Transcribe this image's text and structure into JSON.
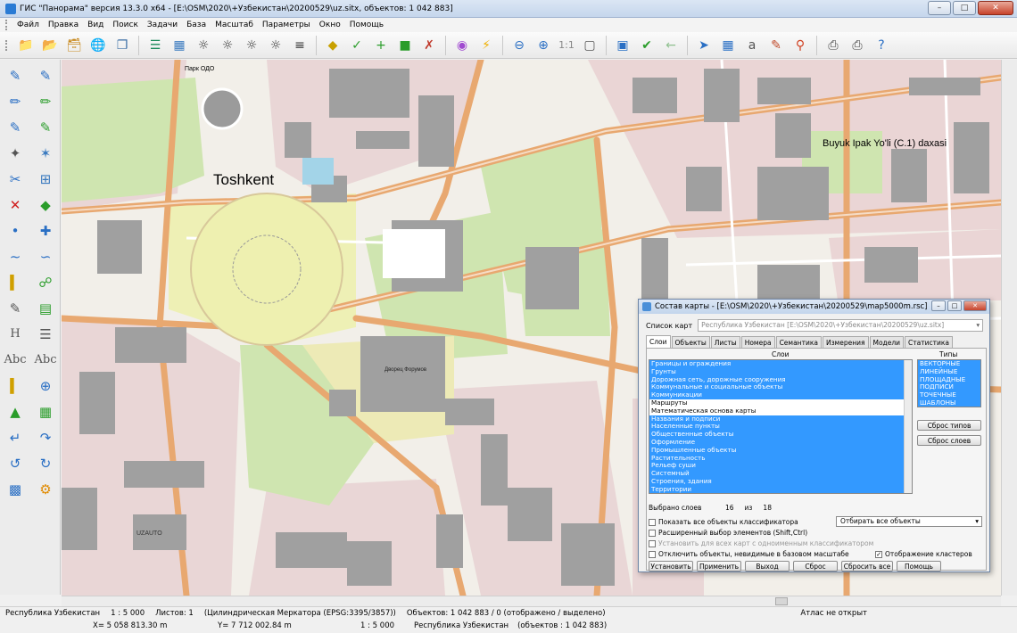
{
  "window": {
    "title": "ГИС \"Панорама\" версия 13.3.0 x64 - [E:\\OSM\\2020\\+Узбекистан\\20200529\\uz.sitx, объектов: 1 042 883]",
    "min": "–",
    "max": "□",
    "close": "✕"
  },
  "menu": [
    "Файл",
    "Правка",
    "Вид",
    "Поиск",
    "Задачи",
    "База",
    "Масштаб",
    "Параметры",
    "Окно",
    "Помощь"
  ],
  "toolbar": {
    "scale_label": "1:1"
  },
  "left_tools": {
    "text1": "H",
    "text2": "Abc",
    "text3": "Abc"
  },
  "map": {
    "labels": {
      "city": "Toshkent",
      "street": "Buyuk Ipak Yo'li (C.1) daxasi",
      "park": "Парк ОДО",
      "uzauto": "UZAUTO",
      "square": "Дворец Форумов"
    }
  },
  "dialog": {
    "title": "Состав карты - [E:\\OSM\\2020\\+Узбекистан\\20200529\\map5000m.rsc]",
    "map_list_label": "Список карт",
    "map_list_value": "Республика Узбекистан [E:\\OSM\\2020\\+Узбекистан\\20200529\\uz.sitx]",
    "tabs": [
      "Слои",
      "Объекты",
      "Листы",
      "Номера",
      "Семантика",
      "Измерения",
      "Модели",
      "Статистика"
    ],
    "layers_header": "Слои",
    "types_header": "Типы",
    "layers": [
      {
        "name": "Границы и ограждения",
        "selected": true
      },
      {
        "name": "Грунты",
        "selected": true
      },
      {
        "name": "Дорожная сеть, дорожные сооружения",
        "selected": true
      },
      {
        "name": "Коммунальные и социальные объекты",
        "selected": true
      },
      {
        "name": "Коммуникации",
        "selected": true
      },
      {
        "name": "Маршруты",
        "selected": false
      },
      {
        "name": "Математическая основа карты",
        "selected": false
      },
      {
        "name": "Названия и подписи",
        "selected": true
      },
      {
        "name": "Населенные пункты",
        "selected": true
      },
      {
        "name": "Общественные объекты",
        "selected": true
      },
      {
        "name": "Оформление",
        "selected": true
      },
      {
        "name": "Промышленные объекты",
        "selected": true
      },
      {
        "name": "Растительность",
        "selected": true
      },
      {
        "name": "Рельеф суши",
        "selected": true
      },
      {
        "name": "Системный",
        "selected": true
      },
      {
        "name": "Строения, здания",
        "selected": true
      },
      {
        "name": "Территории",
        "selected": true
      }
    ],
    "types": [
      "ВЕКТОРНЫЕ",
      "ЛИНЕЙНЫЕ",
      "ПЛОЩАДНЫЕ",
      "ПОДПИСИ",
      "ТОЧЕЧНЫЕ",
      "ШАБЛОНЫ"
    ],
    "reset_types": "Сброс типов",
    "reset_layers": "Сброс слоев",
    "selected_label": "Выбрано слоев",
    "selected_count": "16",
    "of_label": "из",
    "total_count": "18",
    "checkboxes": {
      "show_all": "Показать все объекты классификатора",
      "extended": "Расширенный выбор элементов (Shift,Ctrl)",
      "same_classifier": "Установить для всех карт с одноименным классификатором",
      "disable_invisible": "Отключить объекты, невидимые в базовом масштабе",
      "clusters": "Отображение кластеров"
    },
    "select_mode": "Отбирать все объекты",
    "buttons": {
      "install": "Установить",
      "apply": "Применить",
      "exit": "Выход",
      "reset": "Сброс",
      "reset_all": "Сбросить все",
      "help": "Помощь"
    }
  },
  "status": {
    "line1": {
      "map": "Республика Узбекистан",
      "scale": "1 : 5 000",
      "sheets": "Листов: 1",
      "projection": "(Цилиндрическая Меркатора (EPSG:3395/3857))",
      "objects": "Объектов: 1 042 883 / 0 (отображено / выделено)",
      "atlas": "Атлас не открыт"
    },
    "line2": {
      "x": "X= 5 058 813.30 m",
      "y": "Y= 7 712 002.84 m",
      "scale": "1 : 5 000",
      "map": "Республика Узбекистан",
      "objects": "(объектов : 1 042 883)"
    }
  },
  "colors": {
    "selection": "#3399ff",
    "road": "#e8b37a",
    "park": "#cde4ad",
    "residential": "#ecd3d3",
    "building": "#9b9b9b"
  }
}
